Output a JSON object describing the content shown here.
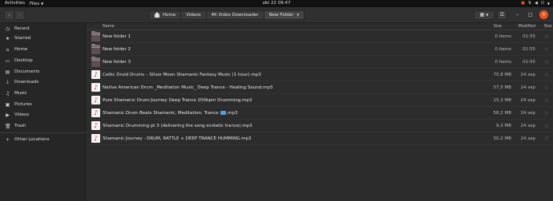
{
  "topbar": {
    "activities": "Activities",
    "app_menu": "Files",
    "clock": "okt 22  09:47"
  },
  "header": {
    "path": [
      "Home",
      "Videos",
      "4K Video Downloader",
      "New Folder"
    ]
  },
  "sidebar": {
    "items": [
      {
        "label": "Recent",
        "icon": "clock-icon"
      },
      {
        "label": "Starred",
        "icon": "star-icon"
      },
      {
        "label": "Home",
        "icon": "home-icon"
      },
      {
        "label": "Desktop",
        "icon": "desktop-icon"
      },
      {
        "label": "Documents",
        "icon": "document-icon"
      },
      {
        "label": "Downloads",
        "icon": "download-icon"
      },
      {
        "label": "Music",
        "icon": "music-icon"
      },
      {
        "label": "Pictures",
        "icon": "picture-icon"
      },
      {
        "label": "Videos",
        "icon": "video-icon"
      },
      {
        "label": "Trash",
        "icon": "trash-icon"
      }
    ],
    "other_locations": "Other Locations"
  },
  "columns": {
    "name": "Name",
    "size": "Size",
    "modified": "Modified",
    "star": "Star"
  },
  "files": [
    {
      "name": "New folder 1",
      "size": "0 items",
      "modified": "01:55",
      "type": "folder"
    },
    {
      "name": "New folder 2",
      "size": "0 items",
      "modified": "01:55",
      "type": "folder"
    },
    {
      "name": "New folder 3",
      "size": "0 items",
      "modified": "01:55",
      "type": "folder"
    },
    {
      "name": "Celtic Druid Drums – Silver Moon  Shamanic Fantasy Music (1 hour).mp3",
      "size": "70,8 MB",
      "modified": "24 sep",
      "type": "audio"
    },
    {
      "name": "Native American Drum _Meditation Music_ Deep Trance - Healing Sound.mp3",
      "size": "57,5 MB",
      "modified": "24 sep",
      "type": "audio"
    },
    {
      "name": "Pure Shamanic Drum Journey  Deep Trance 200bpm Drumming.mp3",
      "size": "15,3 MB",
      "modified": "24 sep",
      "type": "audio"
    },
    {
      "name": "Shamanic Drum Beats   Shamanic, Meditation, Trance",
      "suffix": ".mp3",
      "size": "58,2 MB",
      "modified": "24 sep",
      "type": "audio"
    },
    {
      "name": "Shamanic Drumming pt 3 (delivering the song ecstatic trance).mp3",
      "size": "9,3 MB",
      "modified": "24 sep",
      "type": "audio"
    },
    {
      "name": "Shamanic Journey - DRUM, RATTLE + DEEP TRANCE HUMMING.mp3",
      "size": "30,2 MB",
      "modified": "24 sep",
      "type": "audio"
    }
  ]
}
